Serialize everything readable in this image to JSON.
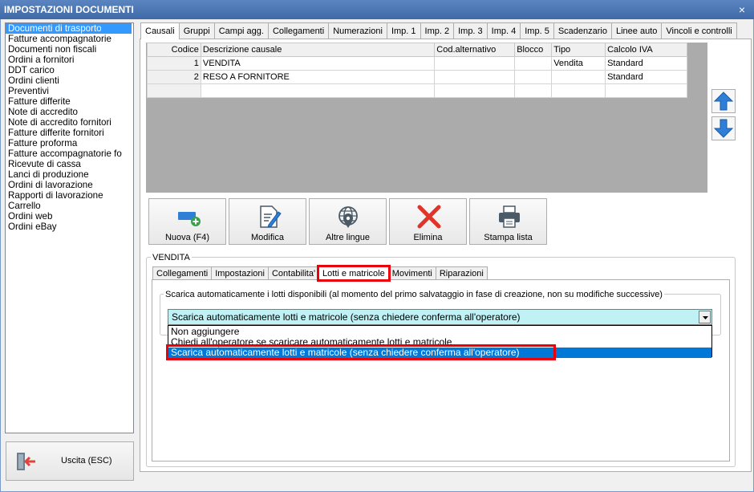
{
  "window": {
    "title": "IMPOSTAZIONI DOCUMENTI",
    "close_label": "×"
  },
  "doc_list": [
    "Documenti di trasporto",
    "Fatture accompagnatorie",
    "Documenti non fiscali",
    "Ordini a fornitori",
    "DDT carico",
    "Ordini clienti",
    "Preventivi",
    "Fatture differite",
    "Note di accredito",
    "Note di accredito fornitori",
    "Fatture differite fornitori",
    "Fatture proforma",
    "Fatture accompagnatorie fo",
    "Ricevute di cassa",
    "Lanci di produzione",
    "Ordini di lavorazione",
    "Rapporti di lavorazione",
    "Carrello",
    "Ordini web",
    "Ordini eBay"
  ],
  "exit_button": {
    "label": "Uscita (ESC)"
  },
  "tabs": [
    "Causali",
    "Gruppi",
    "Campi agg.",
    "Collegamenti",
    "Numerazioni",
    "Imp. 1",
    "Imp. 2",
    "Imp. 3",
    "Imp. 4",
    "Imp. 5",
    "Scadenzario",
    "Linee auto",
    "Vincoli e controlli"
  ],
  "grid": {
    "headers": [
      "Codice",
      "Descrizione causale",
      "Cod.alternativo",
      "Blocco",
      "Tipo",
      "Calcolo IVA"
    ],
    "rows": [
      [
        "1",
        "VENDITA",
        "",
        "",
        "Vendita",
        "Standard"
      ],
      [
        "2",
        "RESO A FORNITORE",
        "",
        "",
        "",
        "Standard"
      ],
      [
        "",
        "",
        "",
        "",
        "",
        ""
      ]
    ]
  },
  "toolbar": {
    "new": "Nuova (F4)",
    "edit": "Modifica",
    "languages": "Altre lingue",
    "delete": "Elimina",
    "print": "Stampa lista"
  },
  "detail": {
    "legend": "VENDITA",
    "subtabs": [
      "Collegamenti",
      "Impostazioni",
      "Contabilita'",
      "Lotti e matricole",
      "Movimenti",
      "Riparazioni"
    ],
    "group_label": "Scarica automaticamente i lotti disponibili (al momento del primo salvataggio in fase di creazione, non su modifiche successive)",
    "combo_value": "Scarica automaticamente lotti e matricole (senza chiedere conferma all'operatore)",
    "options": [
      "Non aggiungere",
      "Chiedi all'operatore se scaricare automaticamente lotti e matricole",
      "Scarica automaticamente lotti e matricole (senza chiedere conferma all'operatore)"
    ]
  },
  "colors": {
    "highlight": "#e8000b",
    "selection": "#0078d7",
    "combo_bg": "#bff1f5",
    "titlebar": "#4a74b4"
  }
}
